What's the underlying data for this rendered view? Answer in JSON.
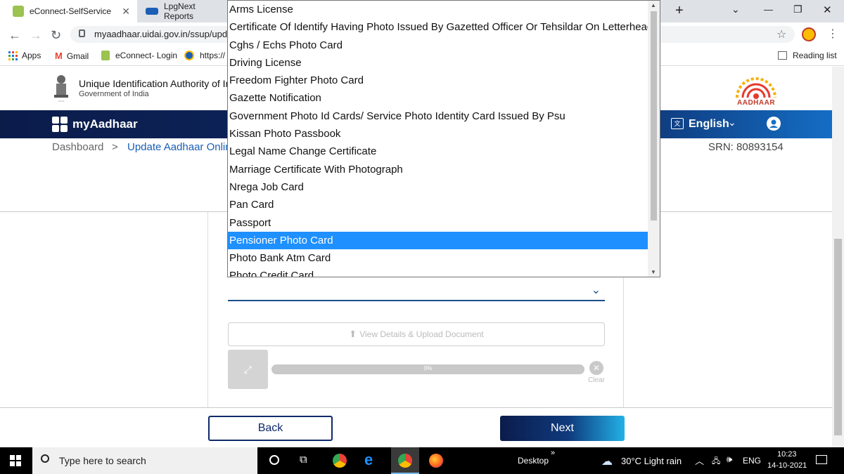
{
  "browser": {
    "tabs": [
      {
        "title": "eConnect-SelfService",
        "close": "✕"
      },
      {
        "title": "LpgNext Reports"
      }
    ],
    "new_tab": "+",
    "url": "myaadhaar.uidai.gov.in/ssup/upd",
    "window_controls": [
      "⌄",
      "—",
      "❐",
      "✕"
    ],
    "bookmarks": [
      "Apps",
      "Gmail",
      "eConnect- Login",
      "https://"
    ],
    "reading_list": "Reading list"
  },
  "header": {
    "org_name": "Unique Identification Authority of India",
    "org_sub": "Government of India",
    "logo_text": "AADHAAR"
  },
  "navbar": {
    "brand": "myAadhaar",
    "language": "English"
  },
  "breadcrumb": {
    "items": [
      "Dashboard",
      "Update Aadhaar Online"
    ],
    "separator": ">",
    "srn": "SRN: 80893154"
  },
  "upload": {
    "button_label": "View Details & Upload Document",
    "progress_label": "0%",
    "progress_value": 0,
    "clear_label": "Clear"
  },
  "footer": {
    "back_label": "Back",
    "next_label": "Next"
  },
  "dropdown": {
    "options": [
      "Arms License",
      "Certificate Of Identify Having Photo Issued By Gazetted Officer Or Tehsildar On Letterhead",
      "Cghs / Echs Photo Card",
      "Driving License",
      "Freedom Fighter Photo Card",
      "Gazette Notification",
      "Government Photo Id Cards/ Service Photo Identity Card Issued By Psu",
      "Kissan Photo Passbook",
      "Legal Name Change Certificate",
      "Marriage Certificate With Photograph",
      "Nrega Job Card",
      "Pan Card",
      "Passport",
      "Pensioner Photo Card",
      "Photo Bank Atm Card",
      "Photo Credit Card"
    ],
    "selected_index": 13
  },
  "taskbar": {
    "search_placeholder": "Type here to search",
    "desktop": "Desktop",
    "weather": "30°C  Light rain",
    "lang": "ENG",
    "time": "10:23",
    "date": "14-10-2021"
  },
  "colors": {
    "accent": "#1e90ff",
    "nav_dark": "#0b1c4b",
    "next_button": "#0e2a6a"
  }
}
